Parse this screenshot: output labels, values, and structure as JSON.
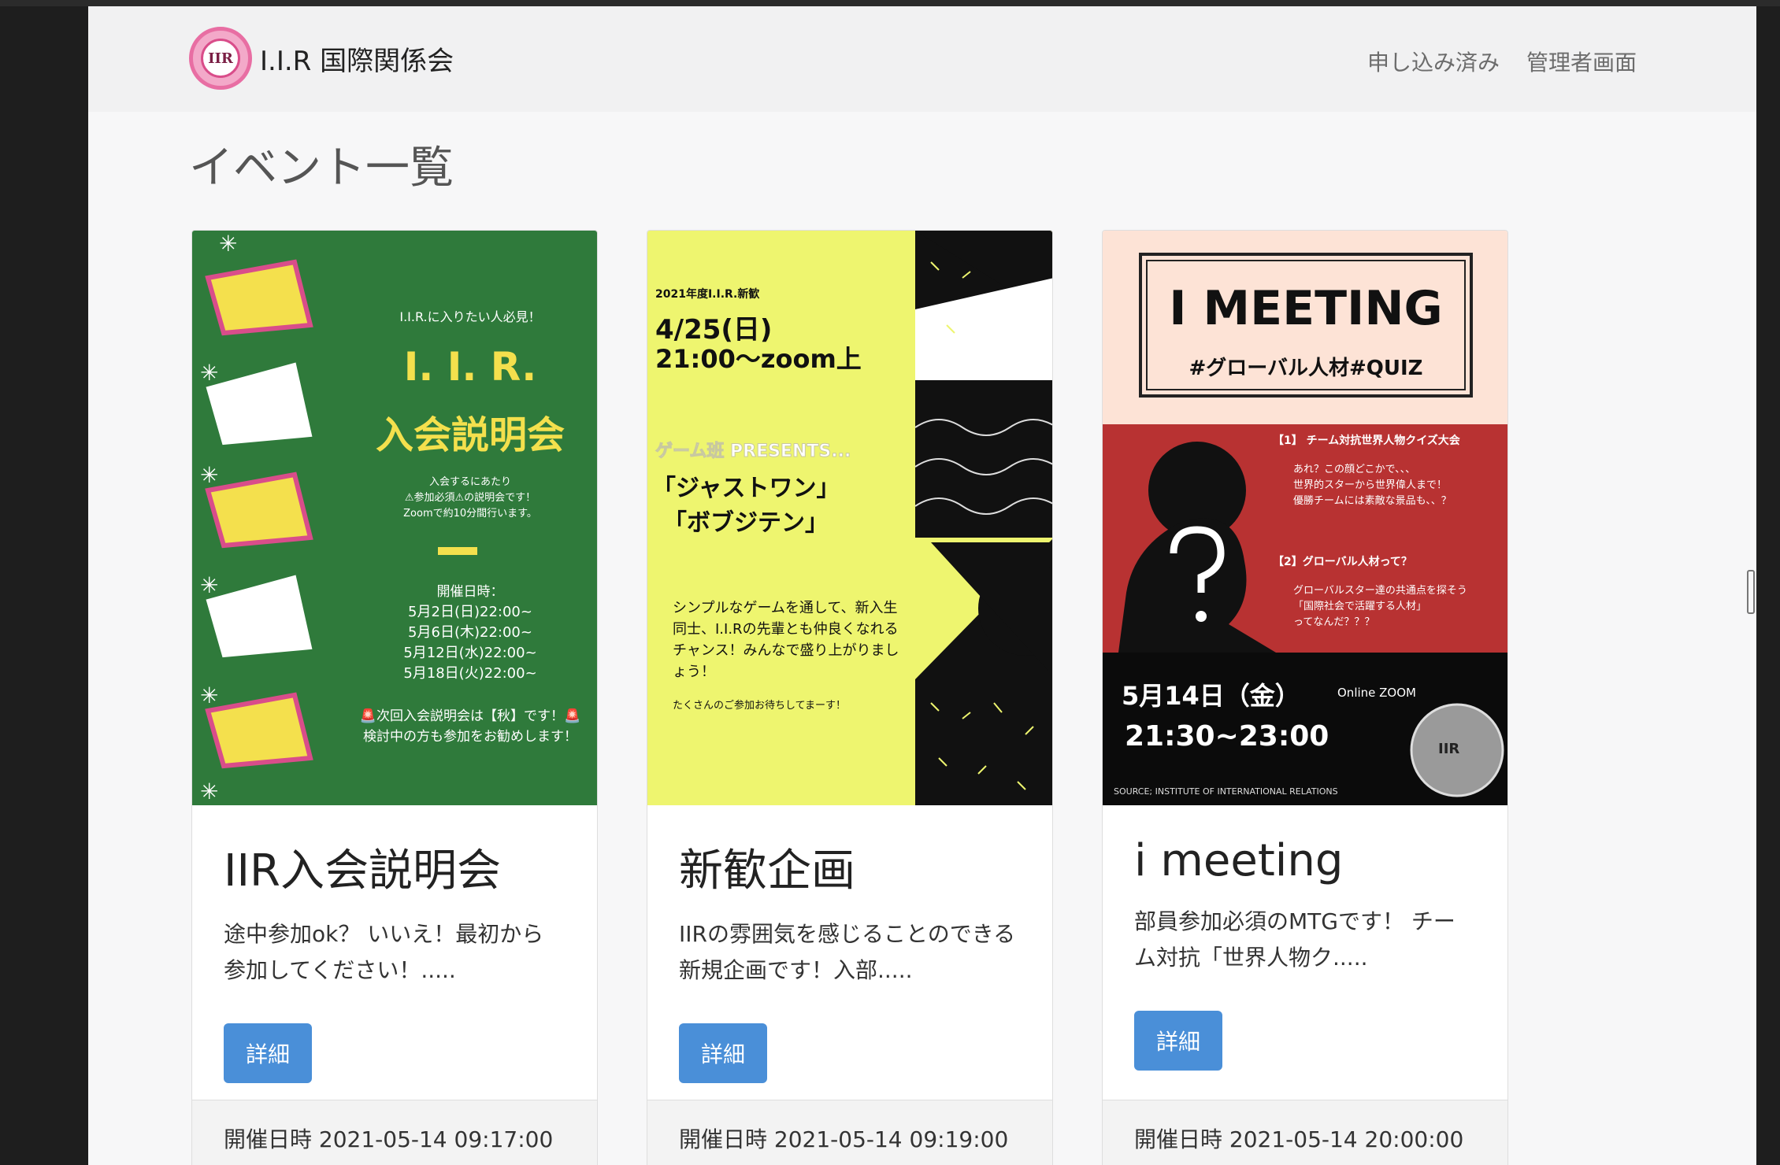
{
  "brand": {
    "name": "I.I.R 国際関係会",
    "logo_text": "IIR"
  },
  "nav": {
    "applied": "申し込み済み",
    "admin": "管理者画面"
  },
  "page": {
    "title": "イベント一覧"
  },
  "cards": [
    {
      "title": "IIR入会説明会",
      "text": "途中参加ok？ いいえ！最初から参加してください！.....",
      "button": "詳細",
      "footer": "開催日時 2021-05-14 09:17:00",
      "poster": {
        "tag": "I.I.R.に入りたい人必見！",
        "headline1": "I. I. R.",
        "headline2": "入会説明会",
        "sub1": "入会するにあたり",
        "sub2": "⚠参加必須⚠の説明会です！",
        "sub3": "Zoomで約10分間行います。",
        "dates_title": "開催日時：",
        "dates": [
          "5月2日(日)22:00~",
          "5月6日(木)22:00~",
          "5月12日(水)22:00~",
          "5月18日(火)22:00~"
        ],
        "note1": "🚨次回入会説明会は【秋】です！🚨",
        "note2": "検討中の方も参加をお勧めします！"
      }
    },
    {
      "title": "新歓企画",
      "text": "IIRの雰囲気を感じることのできる新規企画です！入部.....",
      "button": "詳細",
      "footer": "開催日時 2021-05-14 09:19:00",
      "poster": {
        "tag": "2021年度I.I.R.新歓",
        "date": "4/25(日)",
        "time": "21:00〜zoom上",
        "presents": "ゲーム班 PRESENTS...",
        "game1": "「ジャストワン」",
        "game2": "「ボブジテン」",
        "body": "シンプルなゲームを通して、新入生同士、I.I.Rの先輩とも仲良くなれるチャンス！みんなで盛り上がりましょう！",
        "footer": "たくさんのご参加お待ちしてまーす！"
      }
    },
    {
      "title": "i meeting",
      "text": "部員参加必須のMTGです！ チーム対抗「世界人物ク.....",
      "button": "詳細",
      "footer": "開催日時 2021-05-14 20:00:00",
      "poster": {
        "headline": "I MEETING",
        "tags": "#グローバル人材#QUIZ",
        "s1_title": "【1】 チーム対抗世界人物クイズ大会",
        "s1_lines": [
          "あれ？この顔どこかで、、、",
          "世界的スターから世界偉人まで！",
          "優勝チームには素敵な景品も、、？"
        ],
        "s2_title": "【2】グローバル人材って？",
        "s2_lines": [
          "グローバルスター達の共通点を探そう",
          "「国際社会で活躍する人材」",
          "ってなんだ？？？"
        ],
        "date": "5月14日（金）",
        "online": "Online ZOOM",
        "time": "21:30~23:00",
        "source": "SOURCE; INSTITUTE OF INTERNATIONAL RELATIONS",
        "seal": "IIR"
      }
    }
  ],
  "colors": {
    "accent": "#4a8fd8",
    "poster1_bg": "#2f7a3b",
    "poster2_bg": "#eef56f",
    "poster3_red": "#b83232"
  }
}
